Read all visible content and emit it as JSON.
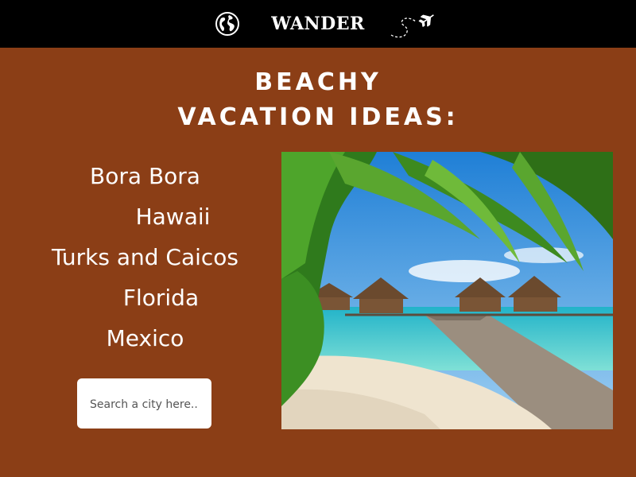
{
  "header": {
    "brand": "WANDER",
    "icons": [
      "globe-icon",
      "airplane-icon"
    ]
  },
  "headline": {
    "line1": "BEACHY",
    "line2": "VACATION IDEAS:"
  },
  "destinations": [
    "Bora Bora",
    "Hawaii",
    "Turks and Caicos",
    "Florida",
    "Mexico"
  ],
  "search": {
    "placeholder": "Search a city here.."
  },
  "colors": {
    "background": "#8b3e16",
    "header": "#000000",
    "text": "#ffffff"
  }
}
